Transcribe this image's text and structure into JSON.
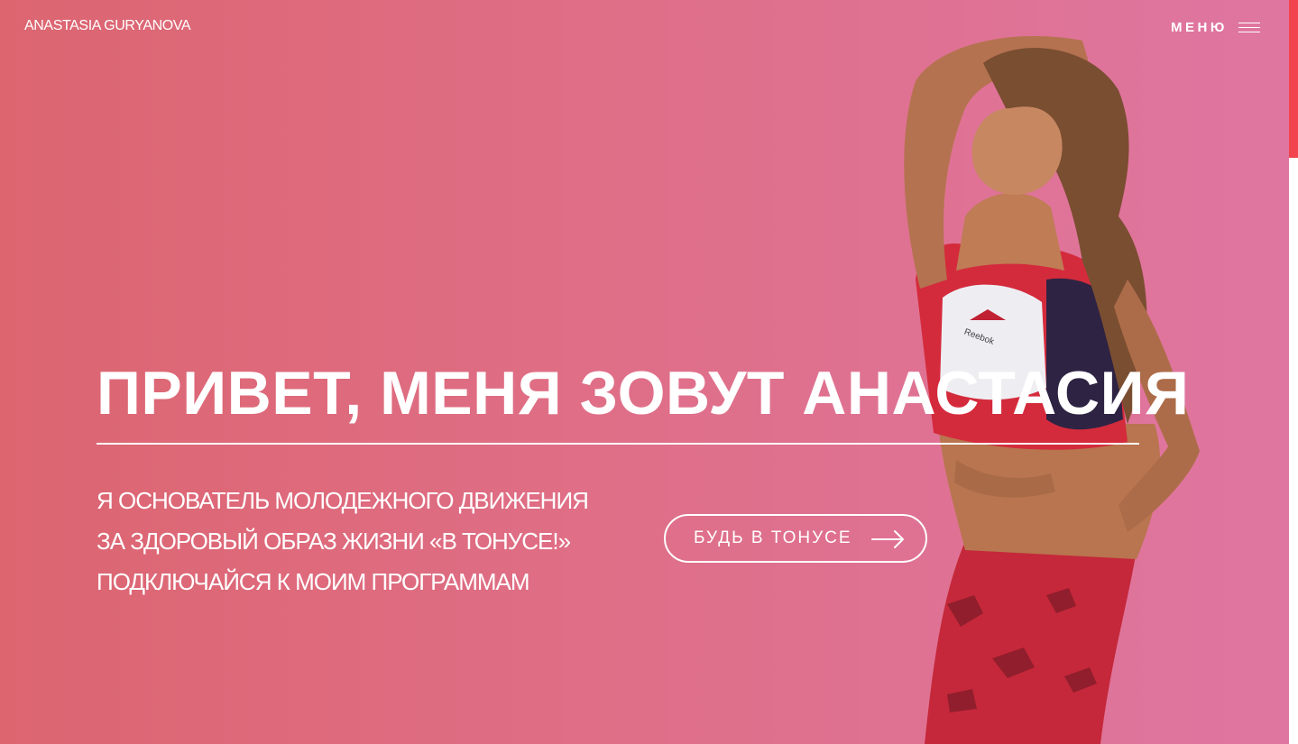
{
  "header": {
    "brand": "ANASTASIA GURYANOVA",
    "menu_label": "МЕНЮ",
    "menu_icon": "hamburger-icon"
  },
  "hero": {
    "title": "ПРИВЕТ, МЕНЯ ЗОВУТ АНАСТАСИЯ",
    "lines": [
      "Я ОСНОВАТЕЛЬ МОЛОДЕЖНОГО ДВИЖЕНИЯ",
      "ЗА ЗДОРОВЫЙ ОБРАЗ ЖИЗНИ «В ТОНУСЕ!»",
      "ПОДКЛЮЧАЙСЯ К МОИМ ПРОГРАММАМ"
    ],
    "cta_label": "БУДЬ В ТОНУСЕ",
    "cta_icon": "arrow-right-icon",
    "top_logo_text": "Reebok"
  },
  "colors": {
    "gradient_start": "#dc6570",
    "gradient_end": "#df76a1",
    "accent": "#f2444e",
    "text": "#ffffff"
  }
}
